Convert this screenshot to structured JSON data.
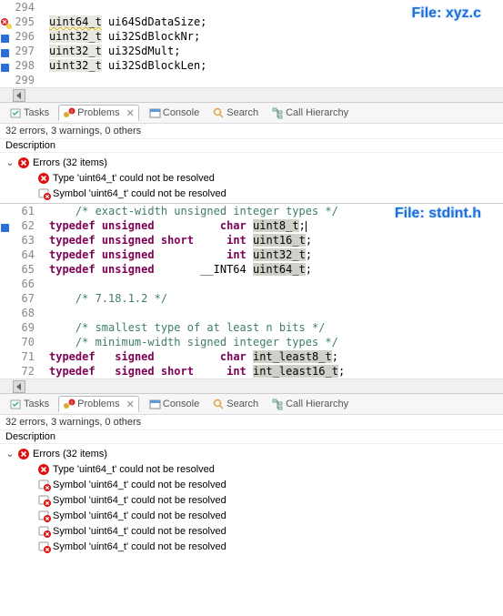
{
  "editor_top": {
    "file_label": "File: xyz.c",
    "lines": [
      {
        "n": "294",
        "code": ""
      },
      {
        "n": "295",
        "code_parts": [
          {
            "t": "uint64_t",
            "cls": "hl-type wavy"
          },
          {
            "t": " ",
            "cls": ""
          },
          {
            "t": "ui64SdDataSize;",
            "cls": "sym"
          }
        ],
        "marker": "error-bulb"
      },
      {
        "n": "296",
        "code_parts": [
          {
            "t": "uint32_t",
            "cls": "hl-type"
          },
          {
            "t": " ",
            "cls": ""
          },
          {
            "t": "ui32SdBlockNr;",
            "cls": "sym"
          }
        ],
        "marker": "breakpoint"
      },
      {
        "n": "297",
        "code_parts": [
          {
            "t": "uint32_t",
            "cls": "hl-type"
          },
          {
            "t": " ",
            "cls": ""
          },
          {
            "t": "ui32SdMult;",
            "cls": "sym"
          }
        ],
        "marker": "breakpoint"
      },
      {
        "n": "298",
        "code_parts": [
          {
            "t": "uint32_t",
            "cls": "hl-type"
          },
          {
            "t": " ",
            "cls": ""
          },
          {
            "t": "ui32SdBlockLen;",
            "cls": "sym"
          }
        ],
        "marker": "breakpoint"
      },
      {
        "n": "299",
        "code": ""
      }
    ]
  },
  "tabs": {
    "tasks": "Tasks",
    "problems": "Problems",
    "console": "Console",
    "search": "Search",
    "callh": "Call Hierarchy",
    "close_x": "✕"
  },
  "status_line": "32 errors, 3 warnings, 0 others",
  "col_description": "Description",
  "tree1": {
    "errors_header": "Errors (32 items)",
    "items": [
      {
        "icon": "error",
        "text": "Type 'uint64_t' could not be resolved"
      },
      {
        "icon": "warn-multi",
        "text": "Symbol 'uint64_t' could not be resolved"
      }
    ]
  },
  "editor_mid": {
    "file_label": "File: stdint.h",
    "lines": [
      {
        "n": "61",
        "code_parts": [
          {
            "t": "    /* exact-width unsigned integer types */",
            "cls": "comment"
          }
        ]
      },
      {
        "n": "62",
        "code_parts": [
          {
            "t": "typedef",
            "cls": "kw"
          },
          {
            "t": " ",
            "cls": ""
          },
          {
            "t": "unsigned",
            "cls": "kw"
          },
          {
            "t": "          ",
            "cls": ""
          },
          {
            "t": "char",
            "cls": "kw"
          },
          {
            "t": " ",
            "cls": ""
          },
          {
            "t": "uint8_t",
            "cls": "typeuse"
          },
          {
            "t": ";",
            "cls": ""
          }
        ],
        "caret": true,
        "marker": "breakpoint"
      },
      {
        "n": "63",
        "code_parts": [
          {
            "t": "typedef",
            "cls": "kw"
          },
          {
            "t": " ",
            "cls": ""
          },
          {
            "t": "unsigned",
            "cls": "kw"
          },
          {
            "t": " ",
            "cls": ""
          },
          {
            "t": "short",
            "cls": "kw"
          },
          {
            "t": "     ",
            "cls": ""
          },
          {
            "t": "int",
            "cls": "kw"
          },
          {
            "t": " ",
            "cls": ""
          },
          {
            "t": "uint16_t",
            "cls": "typeuse"
          },
          {
            "t": ";",
            "cls": ""
          }
        ]
      },
      {
        "n": "64",
        "code_parts": [
          {
            "t": "typedef",
            "cls": "kw"
          },
          {
            "t": " ",
            "cls": ""
          },
          {
            "t": "unsigned",
            "cls": "kw"
          },
          {
            "t": "           ",
            "cls": ""
          },
          {
            "t": "int",
            "cls": "kw"
          },
          {
            "t": " ",
            "cls": ""
          },
          {
            "t": "uint32_t",
            "cls": "typeuse"
          },
          {
            "t": ";",
            "cls": ""
          }
        ]
      },
      {
        "n": "65",
        "code_parts": [
          {
            "t": "typedef",
            "cls": "kw"
          },
          {
            "t": " ",
            "cls": ""
          },
          {
            "t": "unsigned",
            "cls": "kw"
          },
          {
            "t": "       __INT64 ",
            "cls": ""
          },
          {
            "t": "uint64_t",
            "cls": "typeuse"
          },
          {
            "t": ";",
            "cls": ""
          }
        ]
      },
      {
        "n": "66",
        "code_parts": []
      },
      {
        "n": "67",
        "code_parts": [
          {
            "t": "    /* 7.18.1.2 */",
            "cls": "comment"
          }
        ]
      },
      {
        "n": "68",
        "code_parts": []
      },
      {
        "n": "69",
        "code_parts": [
          {
            "t": "    /* smallest type of at least n bits */",
            "cls": "comment"
          }
        ]
      },
      {
        "n": "70",
        "code_parts": [
          {
            "t": "    /* minimum-width signed integer types */",
            "cls": "comment"
          }
        ]
      },
      {
        "n": "71",
        "code_parts": [
          {
            "t": "typedef",
            "cls": "kw"
          },
          {
            "t": "   ",
            "cls": ""
          },
          {
            "t": "signed",
            "cls": "kw"
          },
          {
            "t": "          ",
            "cls": ""
          },
          {
            "t": "char",
            "cls": "kw"
          },
          {
            "t": " ",
            "cls": ""
          },
          {
            "t": "int_least8_t",
            "cls": "typeuse"
          },
          {
            "t": ";",
            "cls": ""
          }
        ]
      },
      {
        "n": "72",
        "code_parts": [
          {
            "t": "typedef",
            "cls": "kw"
          },
          {
            "t": "   ",
            "cls": ""
          },
          {
            "t": "signed",
            "cls": "kw"
          },
          {
            "t": " ",
            "cls": ""
          },
          {
            "t": "short",
            "cls": "kw"
          },
          {
            "t": "     ",
            "cls": ""
          },
          {
            "t": "int",
            "cls": "kw"
          },
          {
            "t": " ",
            "cls": ""
          },
          {
            "t": "int_least16_t",
            "cls": "typeuse"
          },
          {
            "t": ";",
            "cls": ""
          }
        ]
      }
    ]
  },
  "tree2": {
    "errors_header": "Errors (32 items)",
    "items": [
      {
        "icon": "error",
        "text": "Type 'uint64_t' could not be resolved"
      },
      {
        "icon": "warn-multi",
        "text": "Symbol 'uint64_t' could not be resolved"
      },
      {
        "icon": "warn-multi",
        "text": "Symbol 'uint64_t' could not be resolved"
      },
      {
        "icon": "warn-multi",
        "text": "Symbol 'uint64_t' could not be resolved"
      },
      {
        "icon": "warn-multi",
        "text": "Symbol 'uint64_t' could not be resolved"
      },
      {
        "icon": "warn-multi",
        "text": "Symbol 'uint64_t' could not be resolved"
      }
    ]
  }
}
